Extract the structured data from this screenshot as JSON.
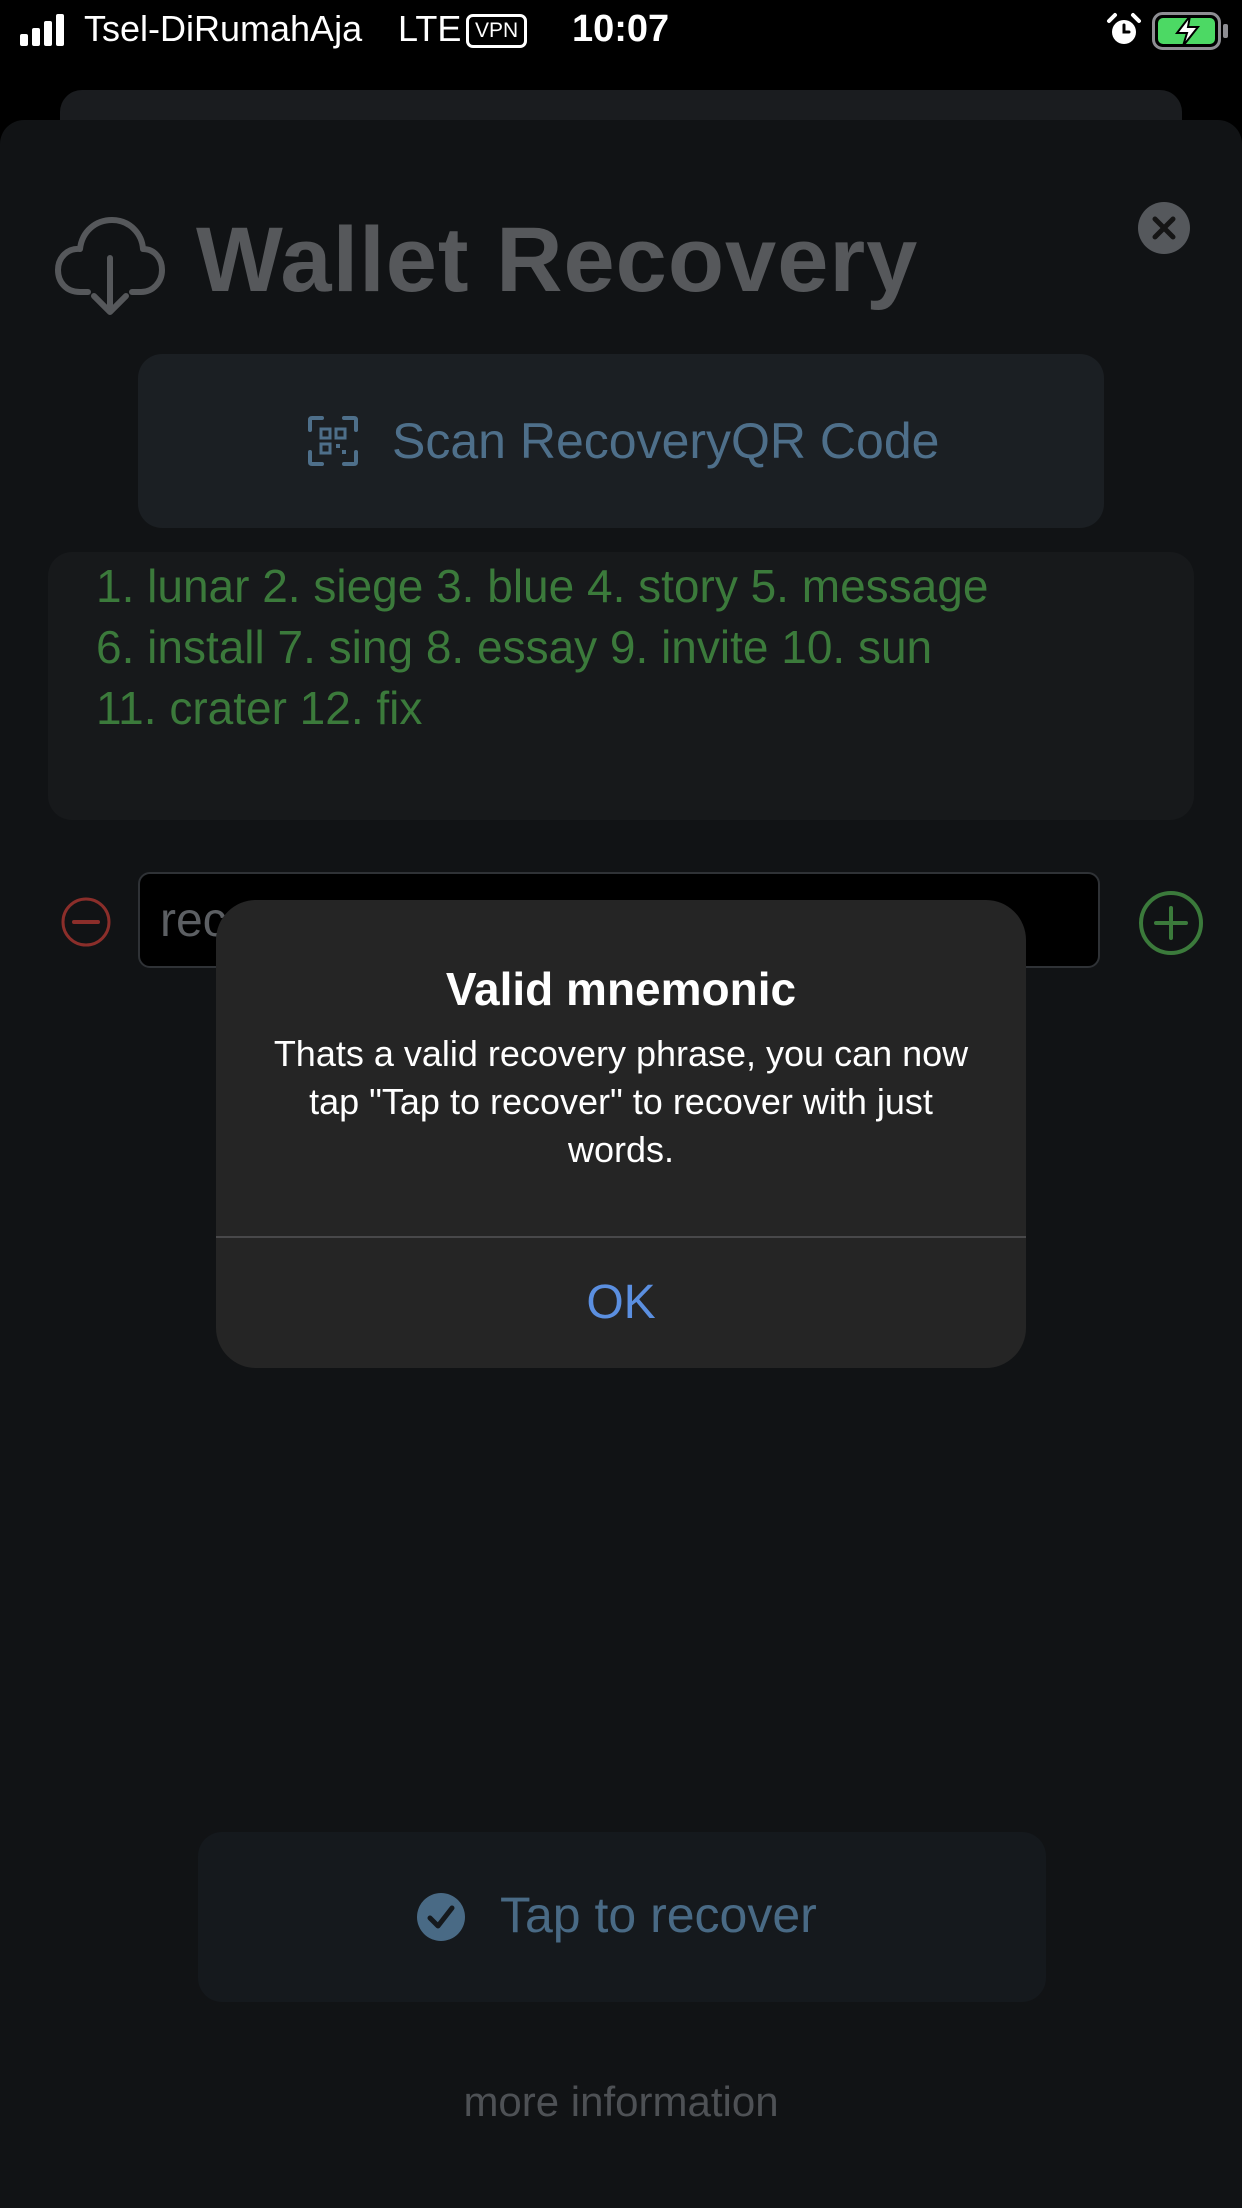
{
  "status_bar": {
    "carrier": "Tsel-DiRumahAja",
    "network": "LTE",
    "vpn": "VPN",
    "time": "10:07",
    "icons": [
      "signal-icon",
      "alarm-icon",
      "battery-charging-icon"
    ]
  },
  "header": {
    "title": "Wallet Recovery",
    "icon": "cloud-download-icon",
    "close_icon": "close-icon"
  },
  "scan_button": {
    "label": "Scan RecoveryQR Code",
    "icon": "qr-code-icon"
  },
  "mnemonic_words_text": "1. lunar  2. siege  3. blue  4. story  5. message\n6. install  7. sing  8. essay  9. invite  10. sun\n11. crater  12. fix",
  "word_input": {
    "value": "rec",
    "remove_icon": "minus-circle-icon",
    "add_icon": "plus-circle-icon"
  },
  "recover_button": {
    "label": "Tap to recover",
    "icon": "checkmark-circle-icon"
  },
  "more_info_label": "more information",
  "alert": {
    "title": "Valid mnemonic",
    "message": "Thats a valid recovery phrase, you can now tap \"Tap to recover\" to recover with just words.",
    "ok_label": "OK"
  },
  "colors": {
    "background": "#000000",
    "sheet": "#111315",
    "words_green": "#3b7a3b",
    "button_text_blue": "#4e6f8a",
    "alert_bg": "#252525",
    "alert_ok": "#5b8fe0",
    "minus_red": "#8b2e2a",
    "plus_green": "#3b7a3b"
  }
}
